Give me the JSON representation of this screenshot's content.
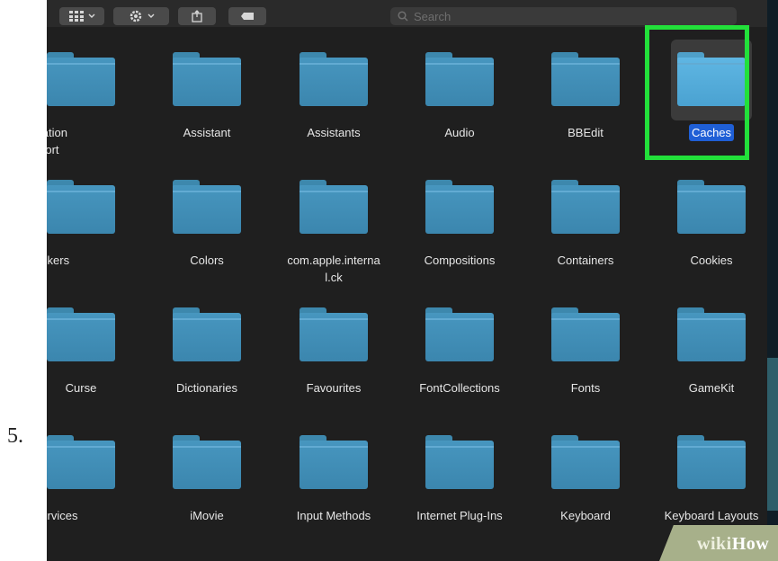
{
  "step_number": "5.",
  "search": {
    "placeholder": "Search"
  },
  "toolbar": {
    "view_icon": "grid-icon",
    "action_icon": "gear-icon",
    "share_icon": "share-icon",
    "tag_icon": "tag-icon"
  },
  "folders": [
    [
      "pplication Support",
      "Assistant",
      "Assistants",
      "Audio",
      "BBEdit",
      "Caches"
    ],
    [
      "lorPickers",
      "Colors",
      "com.apple.internal.ck",
      "Compositions",
      "Containers",
      "Cookies"
    ],
    [
      "Curse",
      "Dictionaries",
      "Favourites",
      "FontCollections",
      "Fonts",
      "GameKit"
    ],
    [
      "tityServices",
      "iMovie",
      "Input Methods",
      "Internet Plug-Ins",
      "Keyboard",
      "Keyboard Layouts"
    ]
  ],
  "selected_folder": "Caches",
  "highlight_color": "#22e03a",
  "selection_color": "#1f5fd6",
  "folder_color": "#4796bf",
  "watermark": {
    "wiki": "wiki",
    "how": "How"
  }
}
